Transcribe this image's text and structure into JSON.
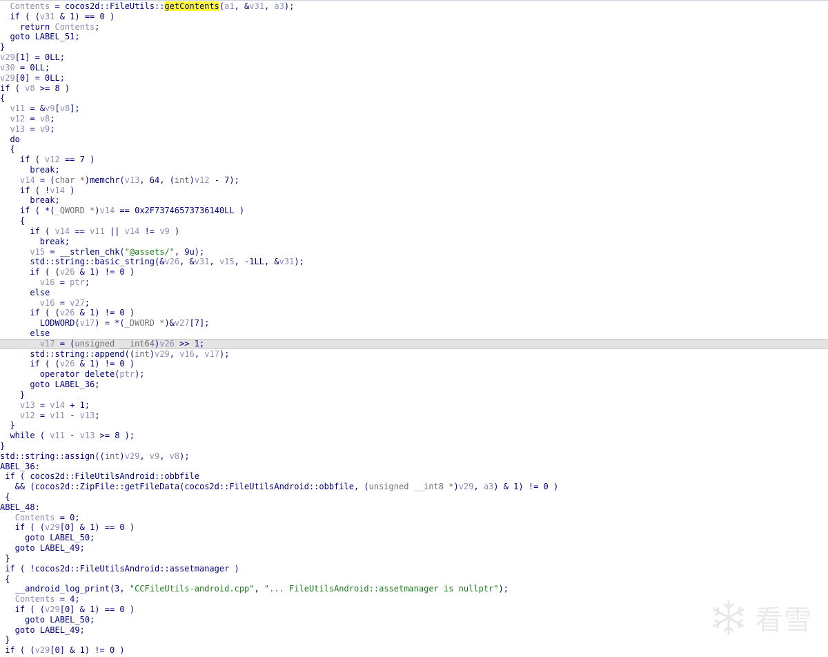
{
  "code_lines": [
    [
      {
        "t": "  "
      },
      {
        "t": "Contents",
        "c": "var"
      },
      {
        "t": " = cocos2d::FileUtils::"
      },
      {
        "t": "getContents",
        "c": "hl"
      },
      {
        "t": "("
      },
      {
        "t": "a1",
        "c": "var"
      },
      {
        "t": ", &"
      },
      {
        "t": "v31",
        "c": "var"
      },
      {
        "t": ", "
      },
      {
        "t": "a3",
        "c": "var"
      },
      {
        "t": ");"
      }
    ],
    [
      {
        "t": "  if ( ("
      },
      {
        "t": "v31",
        "c": "var"
      },
      {
        "t": " & 1) == 0 )"
      }
    ],
    [
      {
        "t": "    return "
      },
      {
        "t": "Contents",
        "c": "var"
      },
      {
        "t": ";"
      }
    ],
    [
      {
        "t": "  goto LABEL_51;"
      }
    ],
    [
      {
        "t": "}"
      }
    ],
    [
      {
        "t": "v29",
        "c": "var"
      },
      {
        "t": "[1] = 0LL;"
      }
    ],
    [
      {
        "t": "v30",
        "c": "var"
      },
      {
        "t": " = 0LL;"
      }
    ],
    [
      {
        "t": "v29",
        "c": "var"
      },
      {
        "t": "[0] = 0LL;"
      }
    ],
    [
      {
        "t": "if ( "
      },
      {
        "t": "v8",
        "c": "var"
      },
      {
        "t": " >= 8 )"
      }
    ],
    [
      {
        "t": "{"
      }
    ],
    [
      {
        "t": "  "
      },
      {
        "t": "v11",
        "c": "var"
      },
      {
        "t": " = &"
      },
      {
        "t": "v9",
        "c": "var"
      },
      {
        "t": "["
      },
      {
        "t": "v8",
        "c": "var"
      },
      {
        "t": "];"
      }
    ],
    [
      {
        "t": "  "
      },
      {
        "t": "v12",
        "c": "var"
      },
      {
        "t": " = "
      },
      {
        "t": "v8",
        "c": "var"
      },
      {
        "t": ";"
      }
    ],
    [
      {
        "t": "  "
      },
      {
        "t": "v13",
        "c": "var"
      },
      {
        "t": " = "
      },
      {
        "t": "v9",
        "c": "var"
      },
      {
        "t": ";"
      }
    ],
    [
      {
        "t": "  do"
      }
    ],
    [
      {
        "t": "  {"
      }
    ],
    [
      {
        "t": "    if ( "
      },
      {
        "t": "v12",
        "c": "var"
      },
      {
        "t": " == 7 )"
      }
    ],
    [
      {
        "t": "      break;"
      }
    ],
    [
      {
        "t": "    "
      },
      {
        "t": "v14",
        "c": "var"
      },
      {
        "t": " = ("
      },
      {
        "t": "char *",
        "c": "type"
      },
      {
        "t": ")memchr("
      },
      {
        "t": "v13",
        "c": "var"
      },
      {
        "t": ", 64, ("
      },
      {
        "t": "int",
        "c": "type"
      },
      {
        "t": ")"
      },
      {
        "t": "v12",
        "c": "var"
      },
      {
        "t": " - 7);"
      }
    ],
    [
      {
        "t": "    if ( !"
      },
      {
        "t": "v14",
        "c": "var"
      },
      {
        "t": " )"
      }
    ],
    [
      {
        "t": "      break;"
      }
    ],
    [
      {
        "t": "    if ( *("
      },
      {
        "t": "_QWORD *",
        "c": "type"
      },
      {
        "t": ")"
      },
      {
        "t": "v14",
        "c": "var"
      },
      {
        "t": " == 0x2F73746573736140LL )"
      }
    ],
    [
      {
        "t": "    {"
      }
    ],
    [
      {
        "t": "      if ( "
      },
      {
        "t": "v14",
        "c": "var"
      },
      {
        "t": " == "
      },
      {
        "t": "v11",
        "c": "var"
      },
      {
        "t": " || "
      },
      {
        "t": "v14",
        "c": "var"
      },
      {
        "t": " != "
      },
      {
        "t": "v9",
        "c": "var"
      },
      {
        "t": " )"
      }
    ],
    [
      {
        "t": "        break;"
      }
    ],
    [
      {
        "t": "      "
      },
      {
        "t": "v15",
        "c": "var"
      },
      {
        "t": " = __strlen_chk("
      },
      {
        "t": "\"@assets/\"",
        "c": "str"
      },
      {
        "t": ", 9u);"
      }
    ],
    [
      {
        "t": "      std::string::basic_string(&"
      },
      {
        "t": "v26",
        "c": "var"
      },
      {
        "t": ", &"
      },
      {
        "t": "v31",
        "c": "var"
      },
      {
        "t": ", "
      },
      {
        "t": "v15",
        "c": "var"
      },
      {
        "t": ", -1LL, &"
      },
      {
        "t": "v31",
        "c": "var"
      },
      {
        "t": ");"
      }
    ],
    [
      {
        "t": "      if ( ("
      },
      {
        "t": "v26",
        "c": "var"
      },
      {
        "t": " & 1) != 0 )"
      }
    ],
    [
      {
        "t": "        "
      },
      {
        "t": "v16",
        "c": "var"
      },
      {
        "t": " = "
      },
      {
        "t": "ptr",
        "c": "var"
      },
      {
        "t": ";"
      }
    ],
    [
      {
        "t": "      else"
      }
    ],
    [
      {
        "t": "        "
      },
      {
        "t": "v16",
        "c": "var"
      },
      {
        "t": " = "
      },
      {
        "t": "v27",
        "c": "var"
      },
      {
        "t": ";"
      }
    ],
    [
      {
        "t": "      if ( ("
      },
      {
        "t": "v26",
        "c": "var"
      },
      {
        "t": " & 1) != 0 )"
      }
    ],
    [
      {
        "t": "        LODWORD("
      },
      {
        "t": "v17",
        "c": "var"
      },
      {
        "t": ") = *("
      },
      {
        "t": "_DWORD *",
        "c": "type"
      },
      {
        "t": ")&"
      },
      {
        "t": "v27",
        "c": "var"
      },
      {
        "t": "[7];"
      }
    ],
    [
      {
        "t": "      else"
      }
    ],
    [
      {
        "t": "        "
      },
      {
        "t": "v17",
        "c": "var"
      },
      {
        "t": " = ("
      },
      {
        "t": "unsigned __int64",
        "c": "type"
      },
      {
        "t": ")"
      },
      {
        "t": "v26",
        "c": "var"
      },
      {
        "t": " >> 1;"
      }
    ],
    [
      {
        "t": "      std::string::append(("
      },
      {
        "t": "int",
        "c": "type"
      },
      {
        "t": ")"
      },
      {
        "t": "v29",
        "c": "var"
      },
      {
        "t": ", "
      },
      {
        "t": "v16",
        "c": "var"
      },
      {
        "t": ", "
      },
      {
        "t": "v17",
        "c": "var"
      },
      {
        "t": ");"
      }
    ],
    [
      {
        "t": "      if ( ("
      },
      {
        "t": "v26",
        "c": "var"
      },
      {
        "t": " & 1) != 0 )"
      }
    ],
    [
      {
        "t": "        operator delete("
      },
      {
        "t": "ptr",
        "c": "var"
      },
      {
        "t": ");"
      }
    ],
    [
      {
        "t": "      goto LABEL_36;"
      }
    ],
    [
      {
        "t": "    }"
      }
    ],
    [
      {
        "t": "    "
      },
      {
        "t": "v13",
        "c": "var"
      },
      {
        "t": " = "
      },
      {
        "t": "v14",
        "c": "var"
      },
      {
        "t": " + 1;"
      }
    ],
    [
      {
        "t": "    "
      },
      {
        "t": "v12",
        "c": "var"
      },
      {
        "t": " = "
      },
      {
        "t": "v11",
        "c": "var"
      },
      {
        "t": " - "
      },
      {
        "t": "v13",
        "c": "var"
      },
      {
        "t": ";"
      }
    ],
    [
      {
        "t": "  }"
      }
    ],
    [
      {
        "t": "  while ( "
      },
      {
        "t": "v11",
        "c": "var"
      },
      {
        "t": " - "
      },
      {
        "t": "v13",
        "c": "var"
      },
      {
        "t": " >= 8 );"
      }
    ],
    [
      {
        "t": "}"
      }
    ],
    [
      {
        "t": "std::string::assign(("
      },
      {
        "t": "int",
        "c": "type"
      },
      {
        "t": ")"
      },
      {
        "t": "v29",
        "c": "var"
      },
      {
        "t": ", "
      },
      {
        "t": "v9",
        "c": "var"
      },
      {
        "t": ", "
      },
      {
        "t": "v8",
        "c": "var"
      },
      {
        "t": ");"
      }
    ],
    [
      {
        "t": "ABEL_36:"
      }
    ],
    [
      {
        "t": " if ( cocos2d::FileUtilsAndroid::obbfile"
      }
    ],
    [
      {
        "t": "   && (cocos2d::ZipFile::getFileData(cocos2d::FileUtilsAndroid::obbfile, ("
      },
      {
        "t": "unsigned __int8 *",
        "c": "type"
      },
      {
        "t": ")"
      },
      {
        "t": "v29",
        "c": "var"
      },
      {
        "t": ", "
      },
      {
        "t": "a3",
        "c": "var"
      },
      {
        "t": ") & 1) != 0 )"
      }
    ],
    [
      {
        "t": " {"
      }
    ],
    [
      {
        "t": "ABEL_48:"
      }
    ],
    [
      {
        "t": "   "
      },
      {
        "t": "Contents",
        "c": "var"
      },
      {
        "t": " = 0;"
      }
    ],
    [
      {
        "t": "   if ( ("
      },
      {
        "t": "v29",
        "c": "var"
      },
      {
        "t": "[0] & 1) == 0 )"
      }
    ],
    [
      {
        "t": "     goto LABEL_50;"
      }
    ],
    [
      {
        "t": "   goto LABEL_49;"
      }
    ],
    [
      {
        "t": " }"
      }
    ],
    [
      {
        "t": " if ( !cocos2d::FileUtilsAndroid::assetmanager )"
      }
    ],
    [
      {
        "t": " {"
      }
    ],
    [
      {
        "t": "   __android_log_print(3, "
      },
      {
        "t": "\"CCFileUtils-android.cpp\"",
        "c": "str"
      },
      {
        "t": ", "
      },
      {
        "t": "\"... FileUtilsAndroid::assetmanager is nullptr\"",
        "c": "str"
      },
      {
        "t": ");"
      }
    ],
    [
      {
        "t": "   "
      },
      {
        "t": "Contents",
        "c": "var"
      },
      {
        "t": " = 4;"
      }
    ],
    [
      {
        "t": "   if ( ("
      },
      {
        "t": "v29",
        "c": "var"
      },
      {
        "t": "[0] & 1) == 0 )"
      }
    ],
    [
      {
        "t": "     goto LABEL_50;"
      }
    ],
    [
      {
        "t": "   goto LABEL_49;"
      }
    ],
    [
      {
        "t": " }"
      }
    ],
    [
      {
        "t": " if ( ("
      },
      {
        "t": "v29",
        "c": "var"
      },
      {
        "t": "[0] & 1) != 0 )"
      }
    ]
  ],
  "current_line_index": 33,
  "colors": {
    "default": "#000080",
    "variable": "#8c8cb4",
    "string": "#1a7a1a",
    "type": "#707070",
    "highlight": "#ffff33",
    "current_line": "#e4e4e4"
  },
  "watermark": {
    "icon": "snowflake-icon",
    "text": "看雪"
  }
}
